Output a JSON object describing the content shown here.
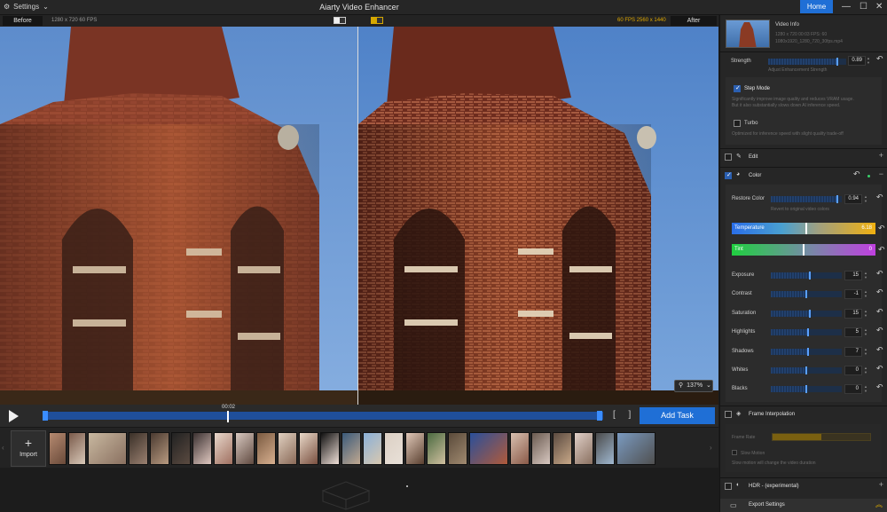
{
  "titlebar": {
    "settings_label": "Settings",
    "app_title": "Aiarty Video Enhancer",
    "home_label": "Home"
  },
  "compare_bar": {
    "before_label": "Before",
    "before_info": "1280 x 720  60 FPS",
    "after_info": "60 FPS  2560 x 1440",
    "after_label": "After"
  },
  "preview": {
    "zoom": "137%"
  },
  "transport": {
    "current_time": "00:02",
    "add_task_label": "Add Task",
    "brackets": "[ ]"
  },
  "strip": {
    "import_label": "Import",
    "thumbnails": [
      {
        "c1": "#b58a70",
        "c2": "#6a4a3a",
        "w": 20
      },
      {
        "c1": "#7a5a4a",
        "c2": "#d8c8b8",
        "w": 20
      },
      {
        "c1": "#c8b8a0",
        "c2": "#8a7060",
        "w": 44
      },
      {
        "c1": "#3a3028",
        "c2": "#9a8070",
        "w": 22
      },
      {
        "c1": "#4a3a30",
        "c2": "#b89a80",
        "w": 22
      },
      {
        "c1": "#222222",
        "c2": "#5a4a40",
        "w": 22
      },
      {
        "c1": "#3a3030",
        "c2": "#e0c8c0",
        "w": 22
      },
      {
        "c1": "#e8d8cc",
        "c2": "#a07060",
        "w": 22
      },
      {
        "c1": "#d8c8c0",
        "c2": "#604a40",
        "w": 22
      },
      {
        "c1": "#7a5a40",
        "c2": "#d8b090",
        "w": 22
      },
      {
        "c1": "#e0d0c0",
        "c2": "#8a6a58",
        "w": 22
      },
      {
        "c1": "#e8d8c8",
        "c2": "#7a5040",
        "w": 22
      },
      {
        "c1": "#101010",
        "c2": "#f0e0d8",
        "w": 22
      },
      {
        "c1": "#3a5a7a",
        "c2": "#c0a890",
        "w": 22
      },
      {
        "c1": "#8ab0d8",
        "c2": "#d8c8b0",
        "w": 22
      },
      {
        "c1": "#dcd0c4",
        "c2": "#e8e0d8",
        "w": 22
      },
      {
        "c1": "#e0c8b8",
        "c2": "#5a4030",
        "w": 22
      },
      {
        "c1": "#4a6a40",
        "c2": "#d0c0a0",
        "w": 22
      },
      {
        "c1": "#5a4a3a",
        "c2": "#a08a70",
        "w": 22
      },
      {
        "c1": "#2a4f9a",
        "c2": "#b05a3a",
        "w": 44
      },
      {
        "c1": "#d8c0b0",
        "c2": "#8a5a48",
        "w": 22
      },
      {
        "c1": "#6a5a50",
        "c2": "#d8c8c0",
        "w": 22
      },
      {
        "c1": "#5a4a40",
        "c2": "#c8a888",
        "w": 22
      },
      {
        "c1": "#e0d0c8",
        "c2": "#8a7060",
        "w": 22
      },
      {
        "c1": "#4a4a4a",
        "c2": "#a0b8d0",
        "w": 22
      },
      {
        "c1": "#7a9ac0",
        "c2": "#505050",
        "w": 44
      }
    ]
  },
  "panel": {
    "video_info": {
      "title": "Video Info",
      "line1": "1280 x 720  00:03  FPS: 60",
      "line2": "1080x1920_1280_720_30fps.mp4"
    },
    "strength": {
      "label": "Strength",
      "value": "0.89",
      "fraction": 0.89,
      "sub": "Adjust Enhancement Strength"
    },
    "step_mode": {
      "label": "Step Mode",
      "desc1": "Significantly improve image quality and reduces VRAM usage.",
      "desc2": "But it also substantially slows down AI inference speed."
    },
    "turbo": {
      "label": "Turbo",
      "desc": "Optimized for inference speed with slight quality trade-off"
    },
    "edit_label": "Edit",
    "color_label": "Color",
    "restore_color": {
      "label": "Restore Color",
      "value": "0.94",
      "fraction": 0.94,
      "sub": "Revert to original video colors"
    },
    "temperature": {
      "label": "Temperature",
      "value": "6.18",
      "fraction": 0.52
    },
    "tint": {
      "label": "Tint",
      "value": "0",
      "fraction": 0.5
    },
    "adjust": [
      {
        "label": "Exposure",
        "value": "15",
        "fraction": 0.55
      },
      {
        "label": "Contrast",
        "value": "-1",
        "fraction": 0.5
      },
      {
        "label": "Saturation",
        "value": "15",
        "fraction": 0.55
      },
      {
        "label": "Highlights",
        "value": "5",
        "fraction": 0.52
      },
      {
        "label": "Shadows",
        "value": "7",
        "fraction": 0.53
      },
      {
        "label": "Whites",
        "value": "0",
        "fraction": 0.5
      },
      {
        "label": "Blacks",
        "value": "0",
        "fraction": 0.5
      }
    ],
    "frame_interp": {
      "label": "Frame Interpolation",
      "frame_rate_label": "Frame Rate",
      "slow_motion_label": "Slow Motion",
      "slow_motion_desc": "Slow motion will change the video duration"
    },
    "hdr_label": "HDR - (experimental)",
    "export_label": "Export Settings"
  },
  "colors": {
    "accent": "#1f6fd6",
    "gold": "#d6a800"
  }
}
